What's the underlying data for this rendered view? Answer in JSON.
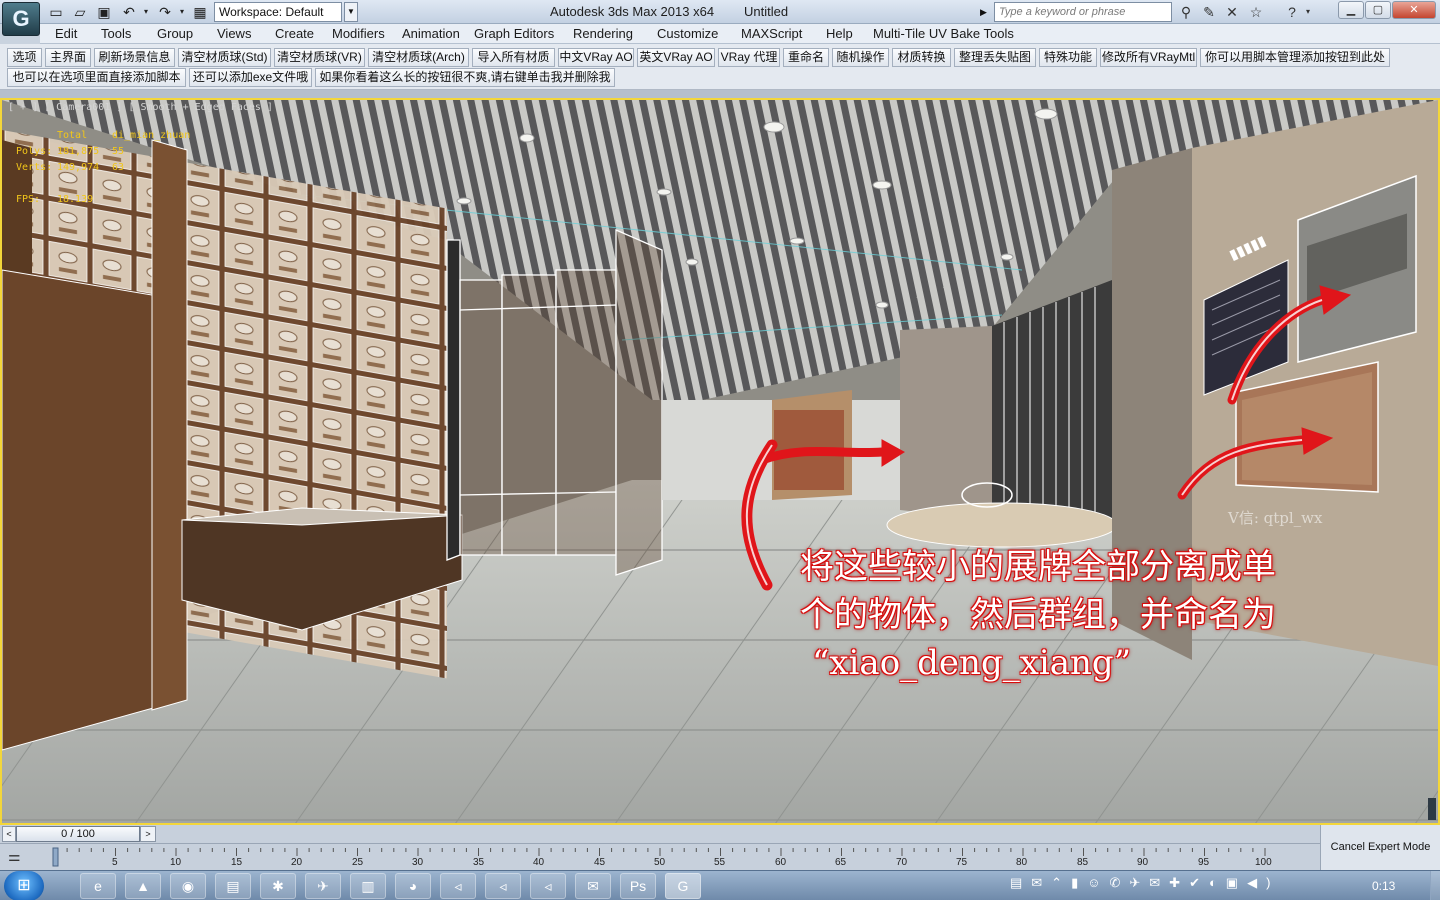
{
  "title_bar": {
    "app_title": "Autodesk 3ds Max  2013 x64",
    "document_title": "Untitled",
    "workspace_label": "Workspace: Default",
    "search_placeholder": "Type a keyword or phrase"
  },
  "menu_bar": [
    "Edit",
    "Tools",
    "Group",
    "Views",
    "Create",
    "Modifiers",
    "Animation",
    "Graph Editors",
    "Rendering",
    "Customize",
    "MAXScript",
    "Help",
    "Multi-Tile UV Bake Tools"
  ],
  "custom_toolbar": {
    "row1": [
      "选项",
      "主界面",
      "刷新场景信息",
      "清空材质球(Std)",
      "清空材质球(VR)",
      "清空材质球(Arch)",
      "导入所有材质",
      "中文VRay AO",
      "英文VRay AO",
      "VRay 代理",
      "重命名",
      "随机操作",
      "材质转换",
      "整理丢失贴图",
      "特殊功能",
      "修改所有VRayMtl",
      "你可以用脚本管理添加按钮到此处"
    ],
    "row2": [
      "也可以在选项里面直接添加脚本",
      "还可以添加exe文件哦",
      "如果你看着这么长的按钮很不爽,请右键单击我并删除我"
    ]
  },
  "viewport": {
    "label": "[ + ] [ Camera001 ] [ Smooth + Edged Faces ]",
    "stats": {
      "col_total": "Total",
      "col_object": "di_mian_zhuan",
      "polys_label": "Polys:",
      "polys_total": "181,875",
      "polys_object": "55",
      "verts_label": "Verts:",
      "verts_total": "149,974",
      "verts_object": "63",
      "fps_label": "FPS:",
      "fps_value": "18.139"
    },
    "annotation_line1": "将这些较小的展牌全部分离成单",
    "annotation_line2": "个的物体，然后群组，并命名为",
    "annotation_line3": "“xiao_deng_xiang”",
    "watermark": "V信: qtpl_wx",
    "colors": {
      "frame": "#f3d63a",
      "arrow": "#e0151a",
      "stats": "#f1c61a"
    }
  },
  "time_slider": {
    "frame_display": "0 / 100",
    "ticks": [
      "5",
      "10",
      "15",
      "20",
      "25",
      "30",
      "35",
      "40",
      "45",
      "50",
      "55",
      "60",
      "65",
      "70",
      "75",
      "80",
      "85",
      "90",
      "95",
      "100"
    ]
  },
  "status": {
    "cancel_expert_mode": "Cancel Expert Mode"
  },
  "taskbar": {
    "clock": "0:13",
    "apps": [
      "ie-icon",
      "terminal-icon",
      "chrome-icon",
      "explorer-icon",
      "bluetooth-icon",
      "plane-icon",
      "chart-icon",
      "qq-browser-icon",
      "vs-icon",
      "vs-icon",
      "vs-icon",
      "wechat-icon",
      "photoshop-icon",
      "3dsmax-icon"
    ],
    "app_glyphs": [
      "e",
      "▲",
      "◉",
      "▤",
      "✱",
      "✈",
      "▥",
      "◕",
      "◃",
      "◃",
      "◃",
      "✉",
      "Ps",
      "G"
    ]
  }
}
